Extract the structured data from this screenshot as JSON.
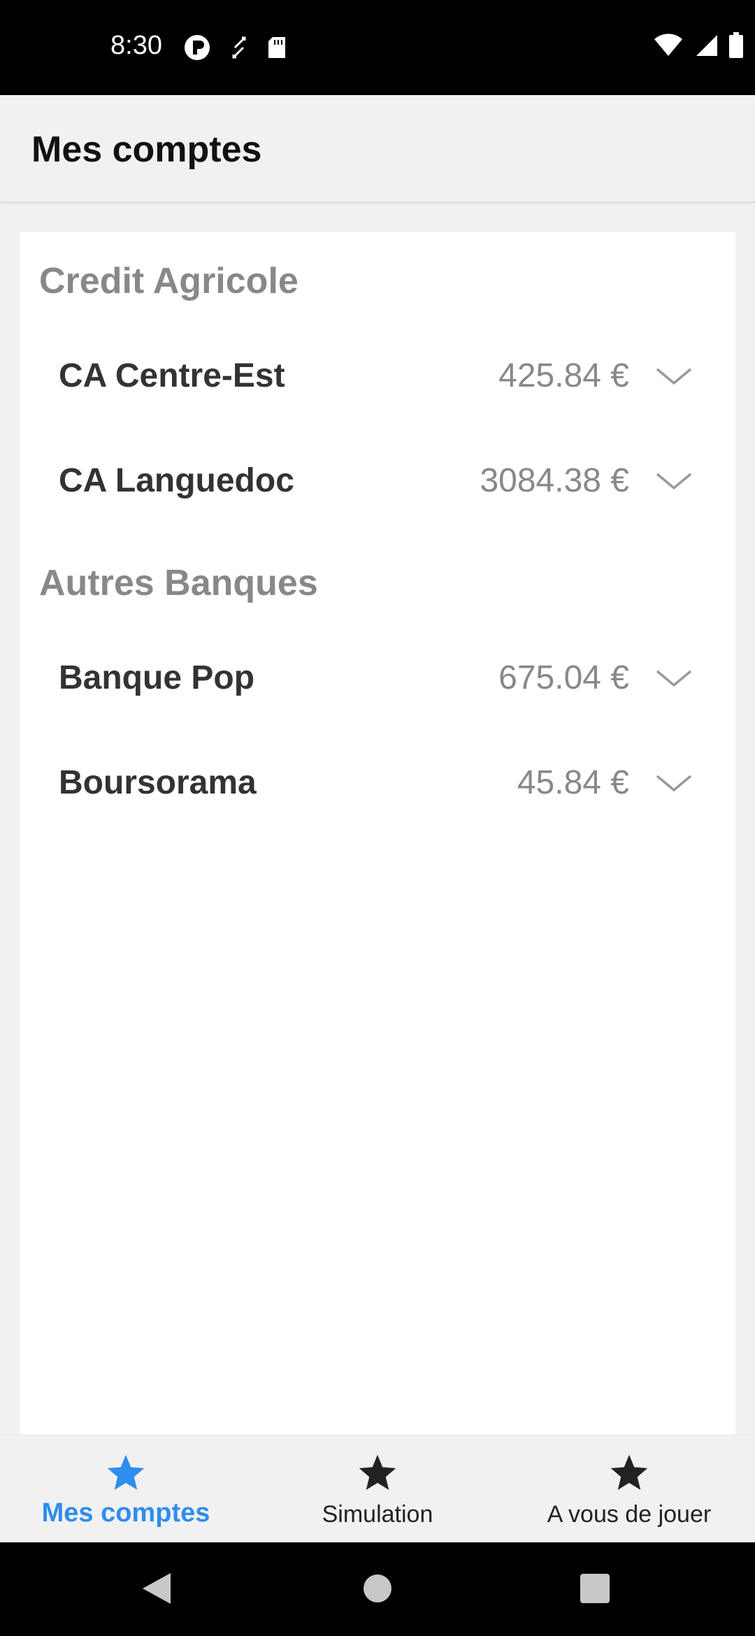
{
  "status_bar": {
    "time": "8:30",
    "left_icons": [
      "media-icon",
      "sync-icon",
      "sd-card-icon"
    ],
    "right_icons": [
      "wifi-icon",
      "signal-icon",
      "battery-icon"
    ]
  },
  "app_bar": {
    "title": "Mes comptes"
  },
  "sections": [
    {
      "title": "Credit Agricole",
      "accounts": [
        {
          "name": "CA Centre-Est",
          "amount": "425.84 €"
        },
        {
          "name": "CA Languedoc",
          "amount": "3084.38 €"
        }
      ]
    },
    {
      "title": "Autres Banques",
      "accounts": [
        {
          "name": "Banque Pop",
          "amount": "675.04 €"
        },
        {
          "name": "Boursorama",
          "amount": "45.84 €"
        }
      ]
    }
  ],
  "bottom_nav": {
    "items": [
      {
        "label": "Mes comptes",
        "icon": "star-icon",
        "active": true
      },
      {
        "label": "Simulation",
        "icon": "star-icon",
        "active": false
      },
      {
        "label": "A vous de jouer",
        "icon": "star-icon",
        "active": false
      }
    ]
  },
  "colors": {
    "accent": "#2e8ded",
    "section_title": "#888888",
    "account_name": "#333333",
    "background": "#f2f1f2"
  }
}
